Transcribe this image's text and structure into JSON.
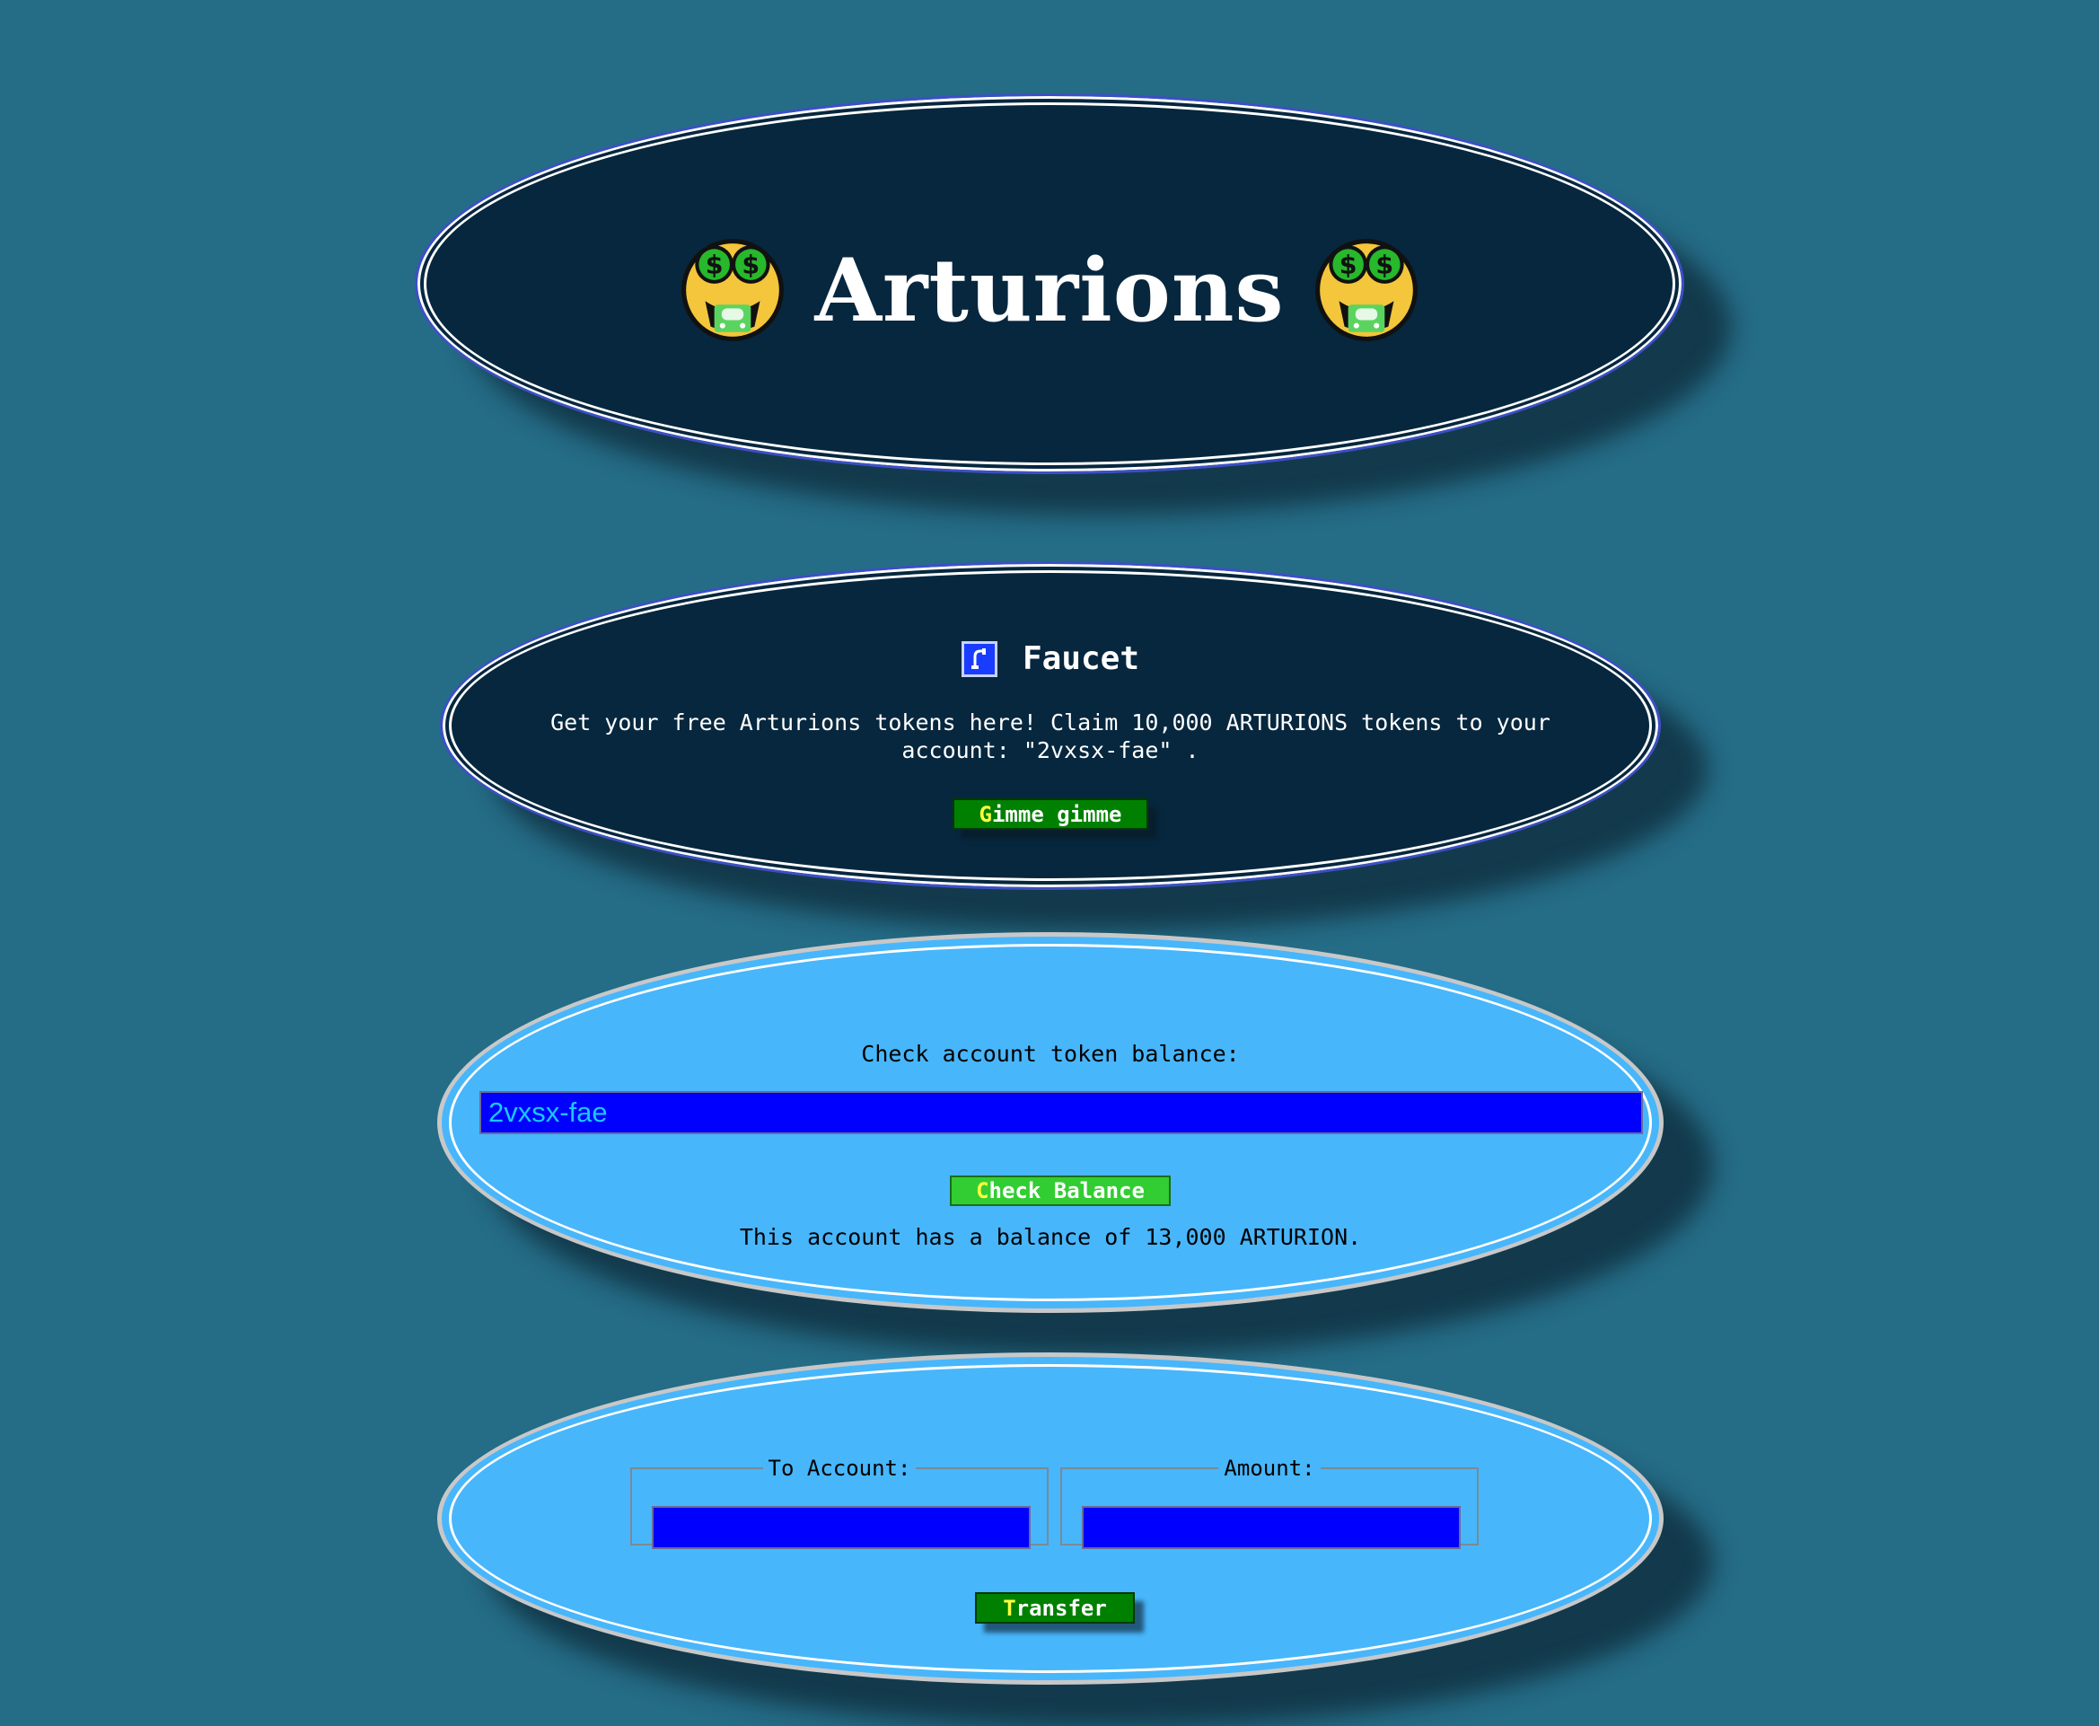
{
  "header": {
    "title": "Arturions",
    "icon": "money-mouth-face-icon"
  },
  "faucet": {
    "icon": "faucet-icon",
    "title": "Faucet",
    "description": "Get your free Arturions tokens here! Claim 10,000 ARTURIONS tokens to your account: \"2vxsx-fae\" .",
    "button_first": "G",
    "button_rest": "imme gimme"
  },
  "balance": {
    "label": "Check account token balance:",
    "input_value": "2vxsx-fae",
    "button_first": "C",
    "button_rest": "heck Balance",
    "result": "This account has a balance of 13,000 ARTURION."
  },
  "transfer": {
    "to_label": "To Account:",
    "amount_label": "Amount:",
    "to_value": "",
    "amount_value": "",
    "button_first": "T",
    "button_rest": "ransfer"
  },
  "colors": {
    "background": "#256c86",
    "dark_panel": "#06273e",
    "light_panel": "#48b6fb",
    "input_bg": "#0000ff",
    "input_text": "#19c8ff",
    "button_green": "#008000",
    "button_lime": "#32cd32",
    "button_accent": "#ffff40"
  }
}
